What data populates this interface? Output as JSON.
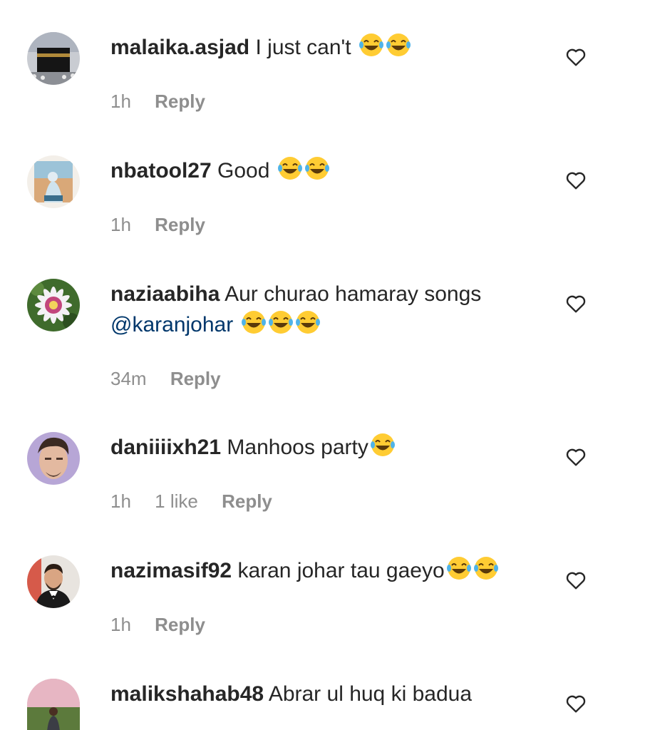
{
  "comments": [
    {
      "username": "malaika.asjad",
      "text": "I just can't",
      "emoji_count": 2,
      "time": "1h",
      "likes": "",
      "reply": "Reply"
    },
    {
      "username": "nbatool27",
      "text": "Good",
      "emoji_count": 2,
      "time": "1h",
      "likes": "",
      "reply": "Reply"
    },
    {
      "username": "naziaabiha",
      "text": "Aur churao hamaray songs",
      "mention": "@karanjohar",
      "emoji_count": 3,
      "time": "34m",
      "likes": "",
      "reply": "Reply"
    },
    {
      "username": "daniiiixh21",
      "text": "Manhoos party",
      "emoji_count": 1,
      "time": "1h",
      "likes": "1 like",
      "reply": "Reply"
    },
    {
      "username": "nazimasif92",
      "text": "karan johar tau gaeyo",
      "emoji_count": 2,
      "time": "1h",
      "likes": "",
      "reply": "Reply"
    },
    {
      "username": "malikshahab48",
      "text": "Abrar ul huq ki badua",
      "emoji_count": 0,
      "time": "",
      "likes": "",
      "reply": ""
    }
  ],
  "icons": {
    "emoji": "face-with-tears-of-joy-icon",
    "like": "heart-outline-icon"
  },
  "colors": {
    "text": "#262626",
    "meta": "#8e8e8e",
    "mention": "#00376b"
  }
}
